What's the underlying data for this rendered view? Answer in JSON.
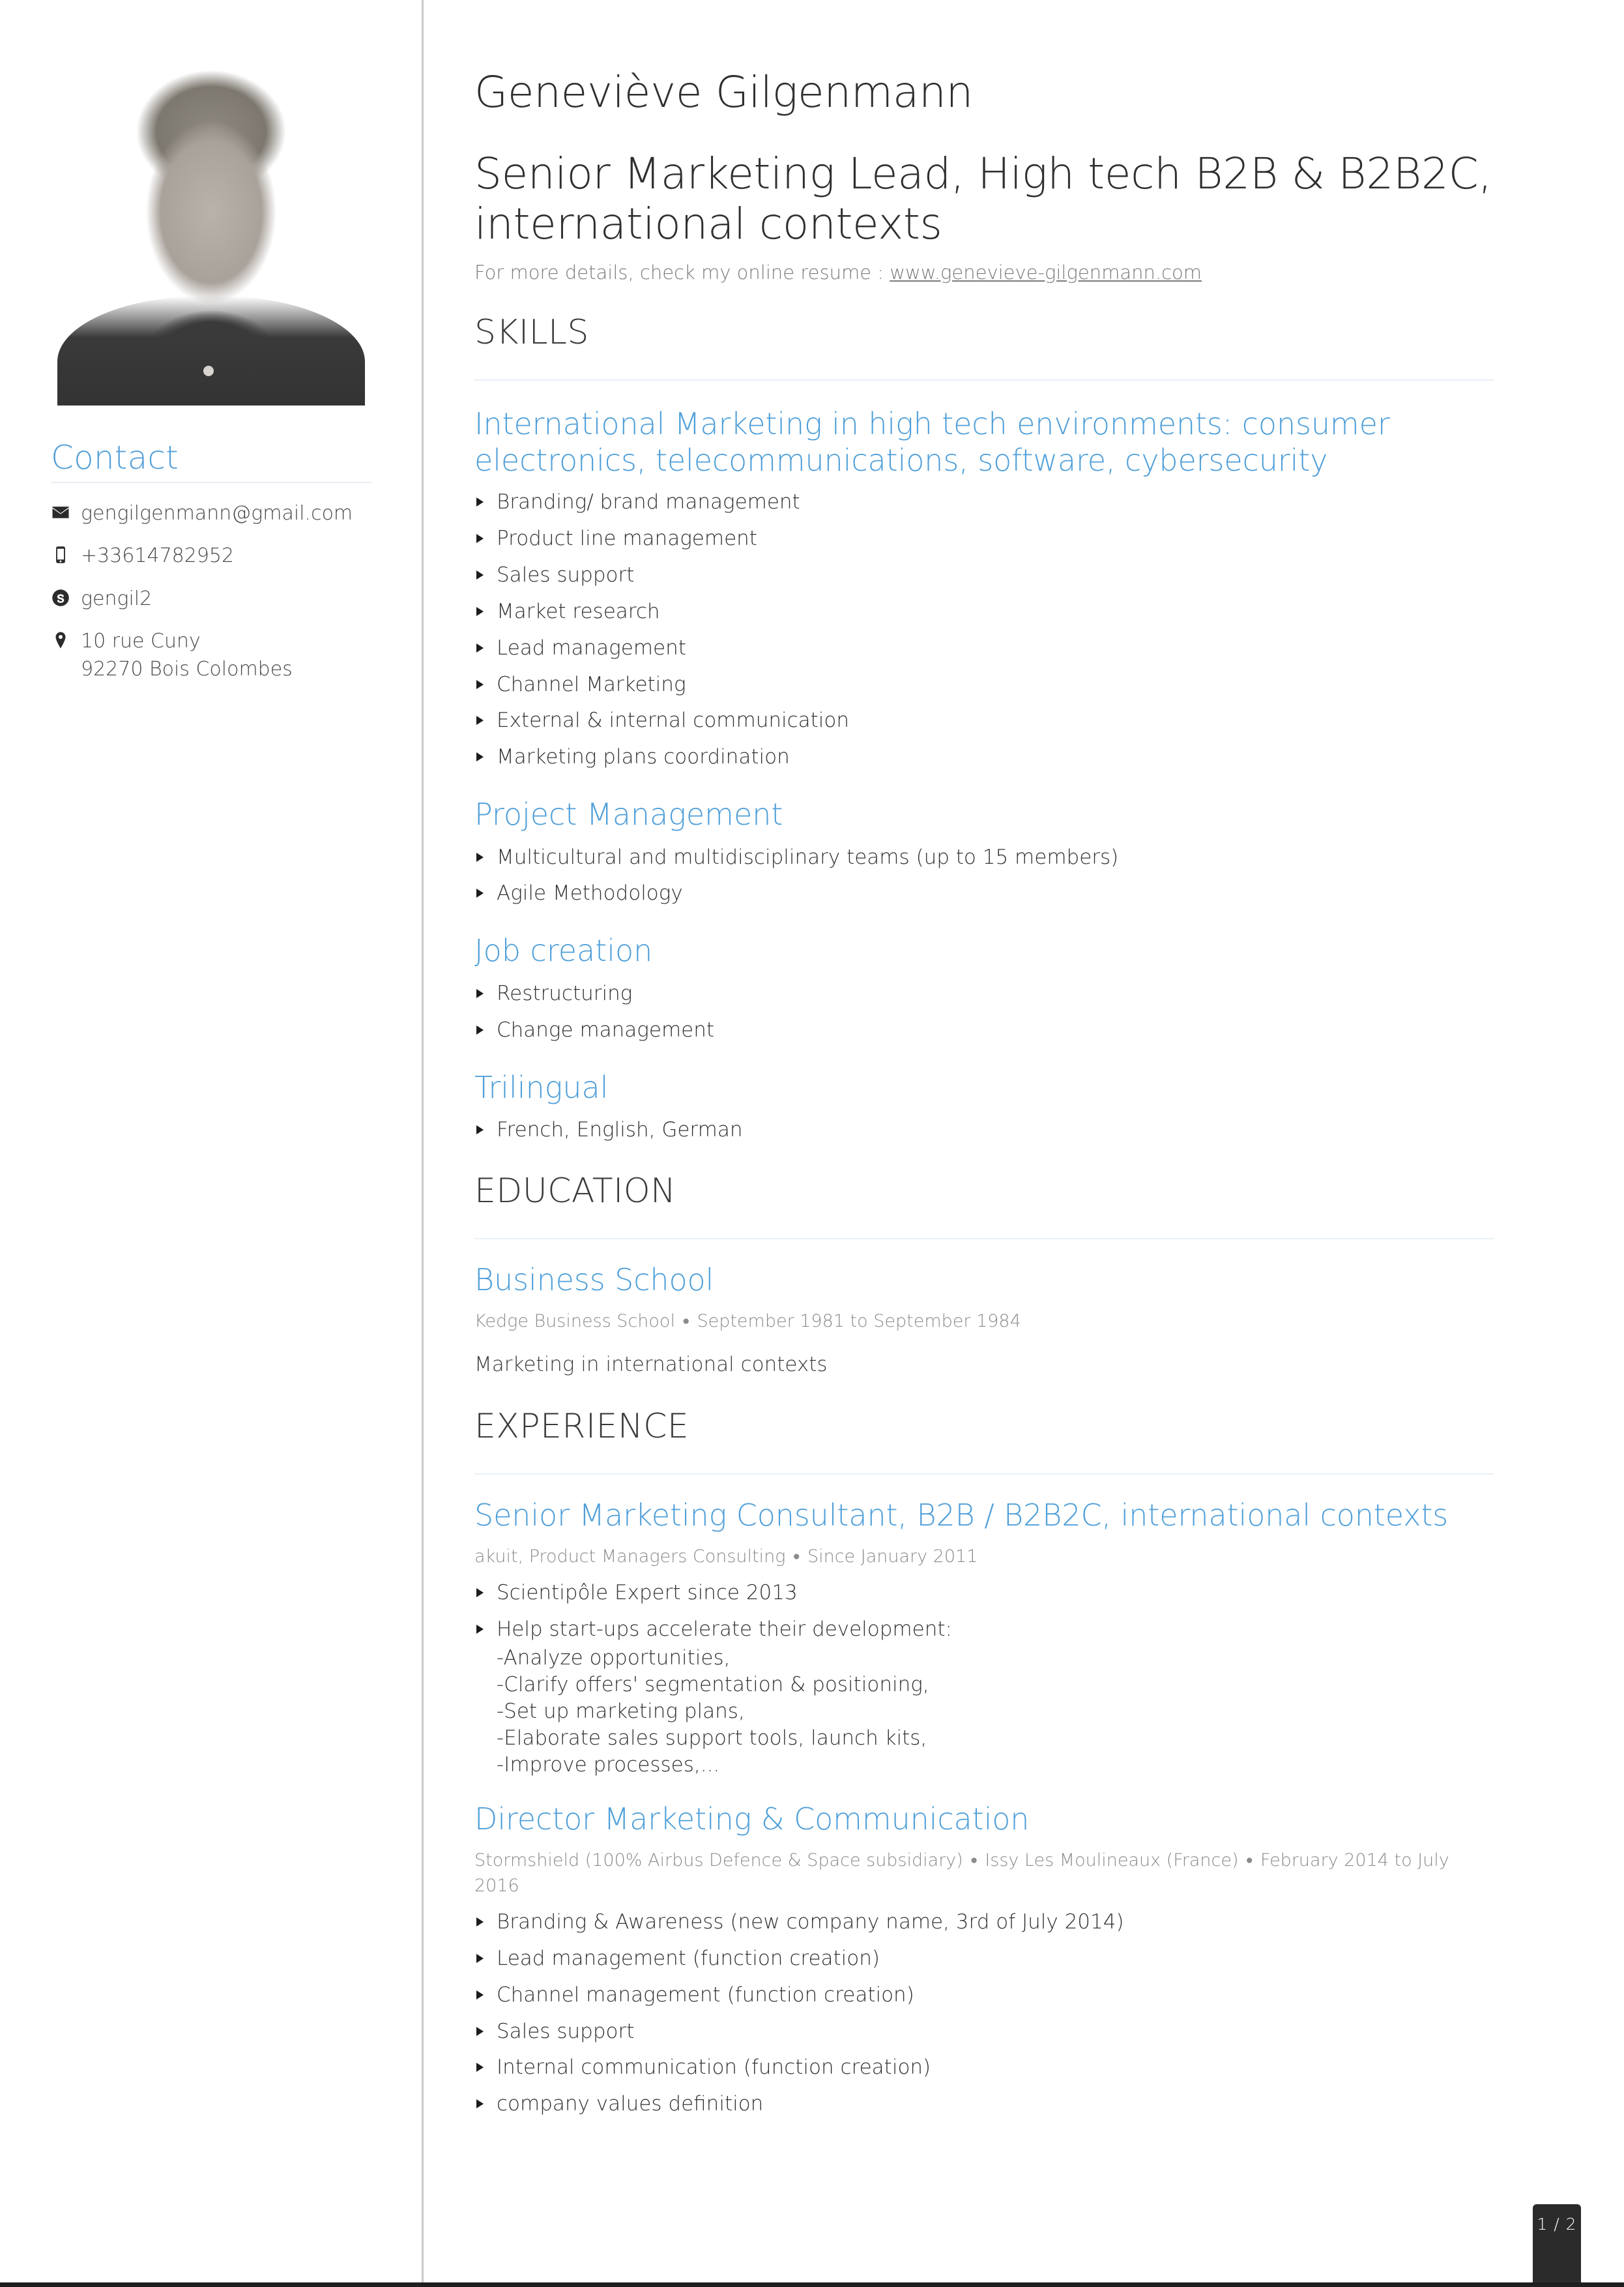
{
  "profile": {
    "name": "Geneviève Gilgenmann",
    "headline": "Senior Marketing Lead, High tech B2B & B2B2C, international contexts",
    "tagline_prefix": "For more details, check my online resume : ",
    "tagline_url": "www.genevieve-gilgenmann.com"
  },
  "sidebar": {
    "contact_heading": "Contact",
    "items": [
      {
        "icon": "envelope-icon",
        "value": "gengilgenmann@gmail.com",
        "value2": ""
      },
      {
        "icon": "mobile-phone-icon",
        "value": "+33614782952",
        "value2": ""
      },
      {
        "icon": "skype-icon",
        "value": "gengil2",
        "value2": ""
      },
      {
        "icon": "location-pin-icon",
        "value": "10 rue Cuny",
        "value2": "92270 Bois Colombes"
      }
    ]
  },
  "sections": {
    "skills": {
      "title": "SKILLS",
      "groups": [
        {
          "title": "International Marketing in high tech environments: consumer electronics, telecommunications, software, cybersecurity",
          "items": [
            "Branding/ brand management",
            "Product line management",
            "Sales support",
            "Market research",
            "Lead management",
            "Channel Marketing",
            "External & internal communication",
            "Marketing plans coordination"
          ]
        },
        {
          "title": "Project Management",
          "items": [
            "Multicultural and multidisciplinary teams (up to 15 members)",
            "Agile Methodology"
          ]
        },
        {
          "title": "Job creation",
          "items": [
            "Restructuring",
            "Change management"
          ]
        },
        {
          "title": "Trilingual",
          "items": [
            "French, English, German"
          ]
        }
      ]
    },
    "education": {
      "title": "EDUCATION",
      "entry_title": "Business School",
      "meta_institution": "Kedge Business School",
      "meta_dates": "September 1981 to September 1984",
      "note": "Marketing in international contexts"
    },
    "experience": {
      "title": "EXPERIENCE",
      "entries": [
        {
          "title": "Senior Marketing Consultant, B2B / B2B2C, international contexts",
          "meta_company": "akuit, Product Managers Consulting",
          "meta_dates": "Since January 2011",
          "meta_location": "",
          "bullets": [
            {
              "text": "Scientipôle Expert since 2013",
              "sublines": ""
            },
            {
              "text": "Help start-ups accelerate their development:",
              "sublines": "-Analyze opportunities,\n-Clarify offers' segmentation & positioning,\n-Set up marketing plans,\n-Elaborate sales support tools, launch kits,\n-Improve processes,..."
            }
          ]
        },
        {
          "title": "Director Marketing & Communication",
          "meta_company": "Stormshield (100% Airbus Defence & Space subsidiary)",
          "meta_location": "Issy Les Moulineaux (France)",
          "meta_dates": "February 2014 to July 2016",
          "bullets": [
            {
              "text": "Branding & Awareness (new company name, 3rd of July 2014)",
              "sublines": ""
            },
            {
              "text": "Lead management (function creation)",
              "sublines": ""
            },
            {
              "text": "Channel management (function creation)",
              "sublines": ""
            },
            {
              "text": "Sales support",
              "sublines": ""
            },
            {
              "text": "Internal communication (function creation)",
              "sublines": ""
            },
            {
              "text": "company values definition",
              "sublines": ""
            }
          ]
        }
      ]
    }
  },
  "footer": {
    "page_indicator": "1 / 2"
  },
  "colors": {
    "accent_blue": "#4f9fd9",
    "heading_dark": "#3a3a3a",
    "meta_gray": "#8b8b8b",
    "badge_dark": "#2b2b2b"
  }
}
